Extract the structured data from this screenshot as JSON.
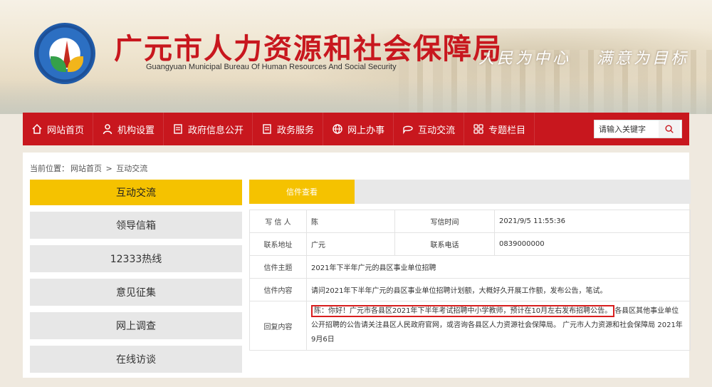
{
  "header": {
    "logo_text": "广元市人力资源和社会保障局",
    "title": "广元市人力资源和社会保障局",
    "subtitle": "Guangyuan Municipal Bureau Of Human Resources And Social Security",
    "slogan_left": "人民为中心",
    "slogan_right": "满意为目标"
  },
  "nav": {
    "items": [
      {
        "label": "网站首页",
        "icon": "home-icon"
      },
      {
        "label": "机构设置",
        "icon": "user-icon"
      },
      {
        "label": "政府信息公开",
        "icon": "document-icon"
      },
      {
        "label": "政务服务",
        "icon": "document-icon"
      },
      {
        "label": "网上办事",
        "icon": "globe-icon"
      },
      {
        "label": "互动交流",
        "icon": "chat-icon"
      },
      {
        "label": "专题栏目",
        "icon": "grid-icon"
      }
    ],
    "search_placeholder": "请输入关键字"
  },
  "breadcrumb": {
    "prefix": "当前位置：",
    "home": "网站首页",
    "sep": " > ",
    "current": "互动交流"
  },
  "sidebar": {
    "items": [
      {
        "label": "互动交流",
        "active": true
      },
      {
        "label": "领导信箱",
        "active": false
      },
      {
        "label": "12333热线",
        "active": false
      },
      {
        "label": "意见征集",
        "active": false
      },
      {
        "label": "网上调查",
        "active": false
      },
      {
        "label": "在线访谈",
        "active": false
      }
    ]
  },
  "content": {
    "tab_label": "信件查看",
    "letter": {
      "writer_label": "写 信 人",
      "writer": "陈",
      "time_label": "写信时间",
      "time": "2021/9/5 11:55:36",
      "address_label": "联系地址",
      "address": "广元",
      "phone_label": "联系电话",
      "phone": "0839000000",
      "subject_label": "信件主题",
      "subject": "2021年下半年广元的县区事业单位招聘",
      "body_label": "信件内容",
      "body": "请问2021年下半年广元的县区事业单位招聘计划额，大概好久开展工作额，发布公告，笔试。",
      "reply_label": "回复内容",
      "reply_highlight": "陈：你好！广元市各县区2021年下半年考试招聘中小学教师，预计在10月左右发布招聘公告。",
      "reply_rest": "各县区其他事业单位公开招聘的公告请关注县区人民政府官网，或咨询各县区人力资源社会保障局。 广元市人力资源和社会保障局 2021年9月6日"
    }
  },
  "colors": {
    "brand_red": "#c8171e",
    "accent_yellow": "#f5c200",
    "highlight_border": "#d81e1e"
  }
}
